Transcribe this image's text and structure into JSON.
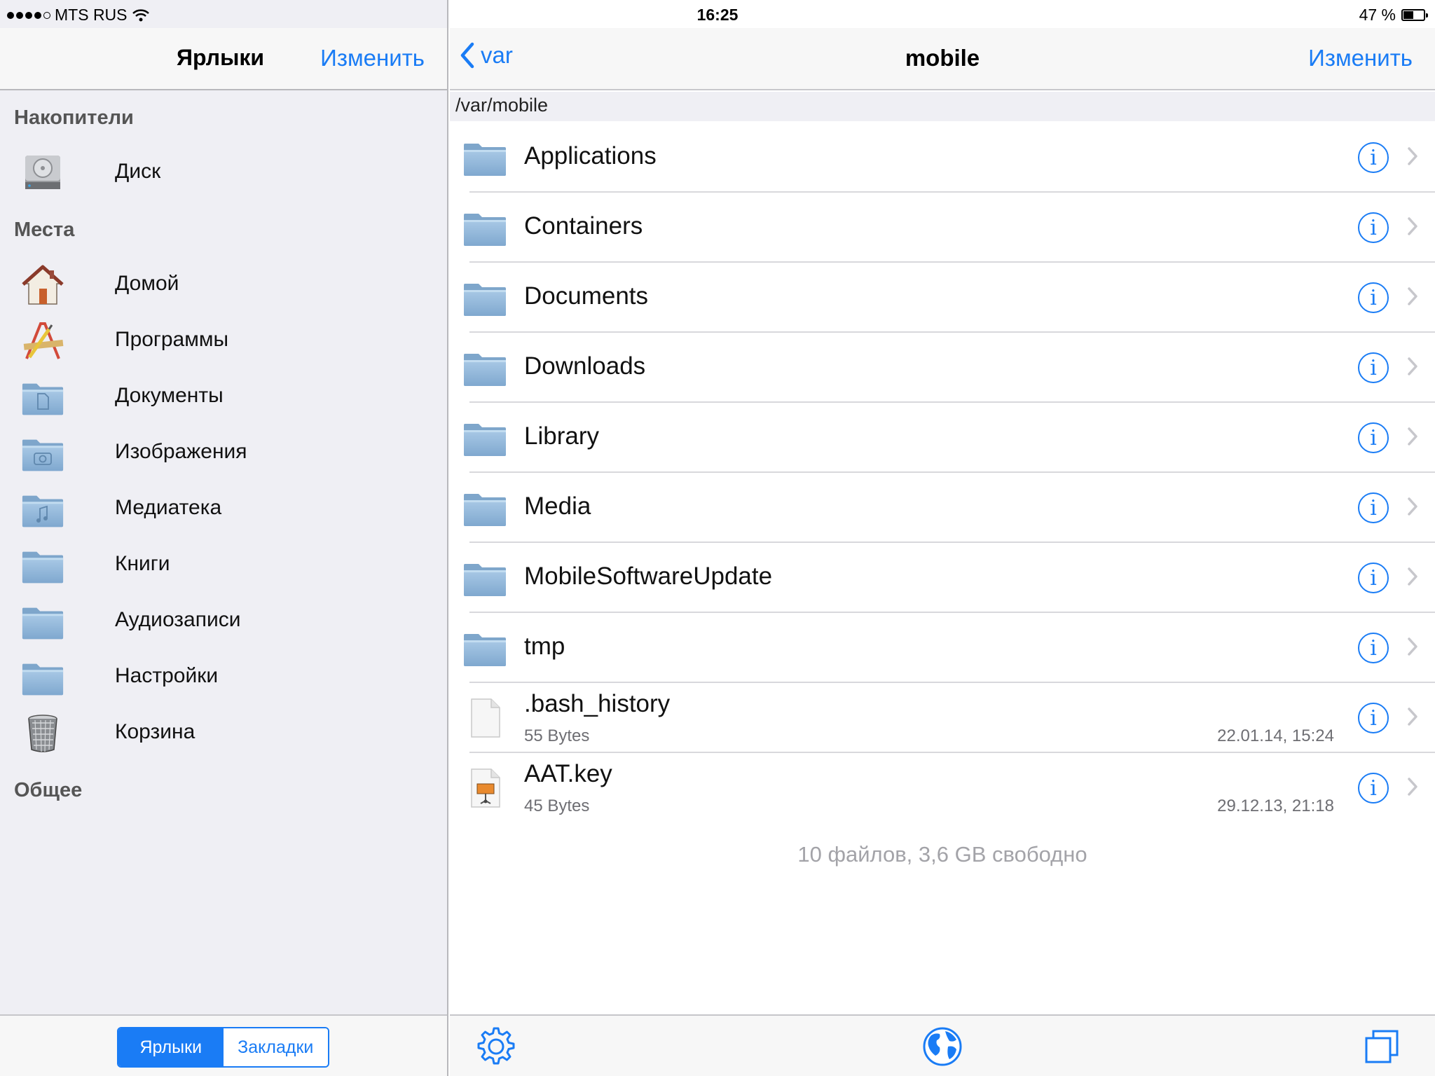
{
  "status": {
    "carrier": "MTS RUS",
    "time": "16:25",
    "battery": "47 %",
    "battery_level": 0.47
  },
  "left": {
    "title": "Ярлыки",
    "edit_label": "Изменить",
    "sections": {
      "storage": "Накопители",
      "places": "Места",
      "general": "Общее"
    },
    "storage_items": [
      {
        "label": "Диск",
        "icon": "hard-disk-icon"
      }
    ],
    "places_items": [
      {
        "label": "Домой",
        "icon": "home-icon"
      },
      {
        "label": "Программы",
        "icon": "applications-icon"
      },
      {
        "label": "Документы",
        "icon": "documents-folder-icon"
      },
      {
        "label": "Изображения",
        "icon": "pictures-folder-icon"
      },
      {
        "label": "Медиатека",
        "icon": "music-folder-icon"
      },
      {
        "label": "Книги",
        "icon": "folder-icon"
      },
      {
        "label": "Аудиозаписи",
        "icon": "folder-icon"
      },
      {
        "label": "Настройки",
        "icon": "folder-icon"
      },
      {
        "label": "Корзина",
        "icon": "trash-icon"
      }
    ],
    "segments": {
      "shortcuts": "Ярлыки",
      "bookmarks": "Закладки"
    }
  },
  "right": {
    "back_label": "var",
    "title": "mobile",
    "edit_label": "Изменить",
    "path": "/var/mobile",
    "folders": [
      {
        "name": "Applications"
      },
      {
        "name": "Containers"
      },
      {
        "name": "Documents"
      },
      {
        "name": "Downloads"
      },
      {
        "name": "Library"
      },
      {
        "name": "Media"
      },
      {
        "name": "MobileSoftwareUpdate"
      },
      {
        "name": "tmp"
      }
    ],
    "files": [
      {
        "name": ".bash_history",
        "size": "55 Bytes",
        "date": "22.01.14, 15:24",
        "icon": "text-file-icon"
      },
      {
        "name": "AAT.key",
        "size": "45 Bytes",
        "date": "29.12.13, 21:18",
        "icon": "keynote-file-icon"
      }
    ],
    "info_glyph": "i",
    "footer": "10 файлов, 3,6 GB свободно"
  },
  "colors": {
    "accent": "#1a7cf5",
    "folder": "#8fb5d8",
    "sidebar_bg": "#efeff4"
  }
}
